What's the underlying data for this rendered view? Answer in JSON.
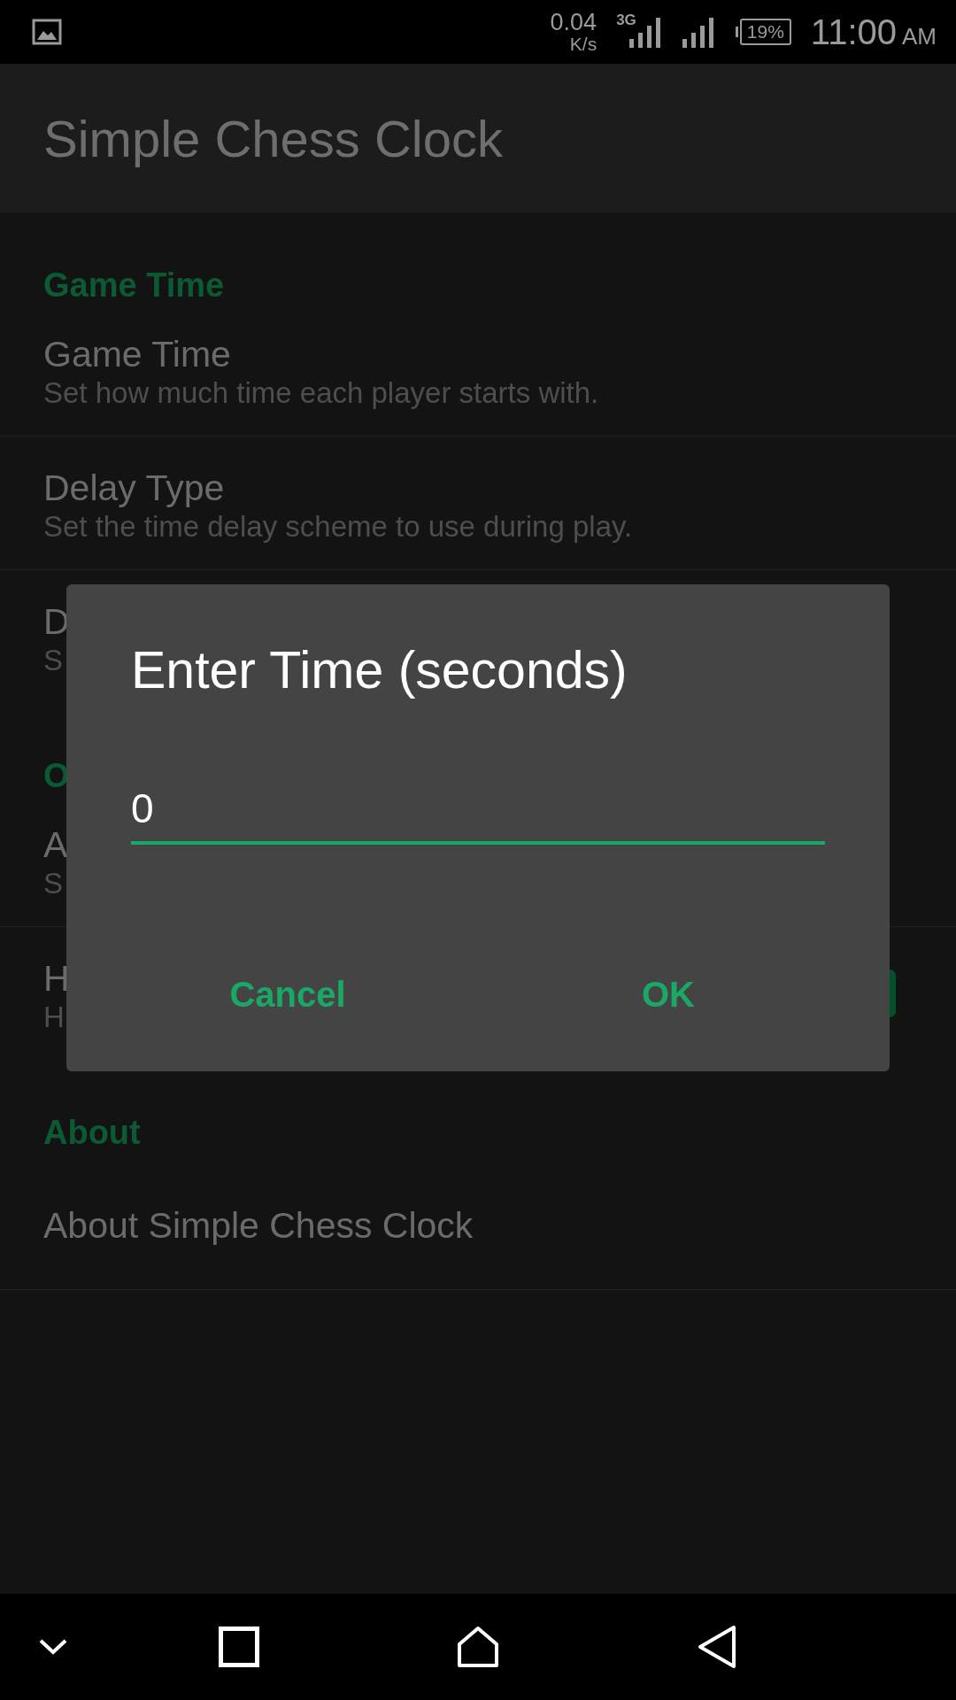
{
  "status_bar": {
    "network_speed": "0.04",
    "network_unit": "K/s",
    "network_type": "3G",
    "battery": "19%",
    "time": "11:00",
    "time_suffix": "AM"
  },
  "app_bar": {
    "title": "Simple Chess Clock"
  },
  "settings": [
    {
      "kind": "header",
      "title": "Game Time"
    },
    {
      "kind": "item",
      "title": "Game Time",
      "subtitle": "Set how much time each player starts with."
    },
    {
      "kind": "item",
      "title": "Delay Type",
      "subtitle": "Set the time delay scheme to use during play."
    },
    {
      "kind": "item",
      "title": "D",
      "subtitle": "S"
    },
    {
      "kind": "header",
      "title": "O"
    },
    {
      "kind": "item",
      "title": "A",
      "subtitle": "S"
    },
    {
      "kind": "item",
      "title": "H",
      "subtitle": "H",
      "toggle": {
        "on": true
      }
    },
    {
      "kind": "header",
      "title": "About"
    },
    {
      "kind": "item",
      "title": "About Simple Chess Clock"
    }
  ],
  "dialog": {
    "title": "Enter Time (seconds)",
    "value": "0",
    "buttons": [
      "Cancel",
      "OK"
    ]
  }
}
